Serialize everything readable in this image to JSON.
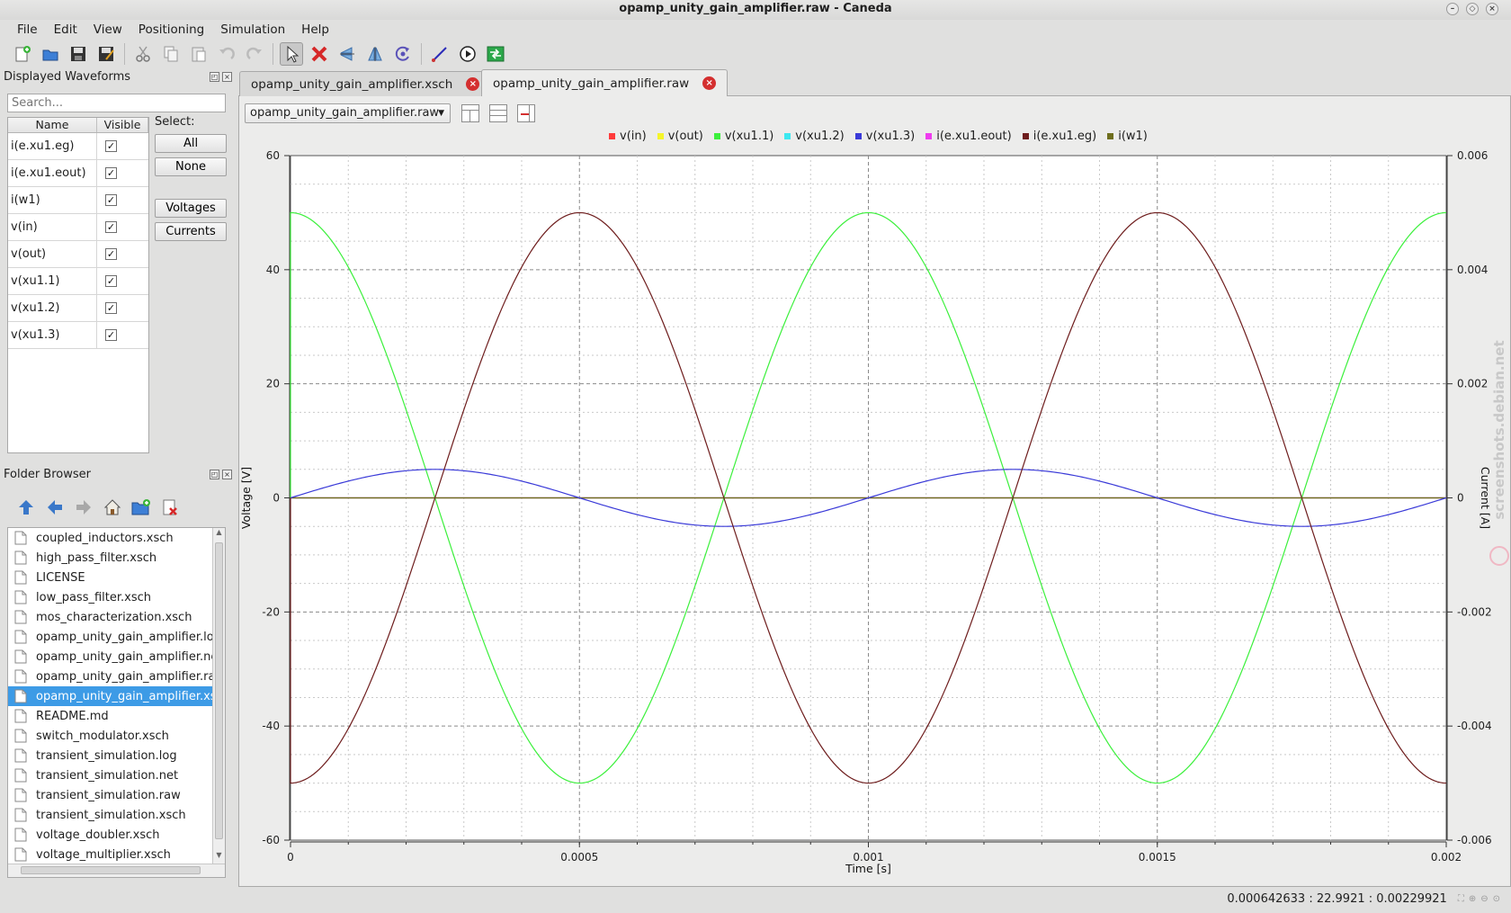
{
  "window": {
    "title": "opamp_unity_gain_amplifier.raw - Caneda"
  },
  "menu": [
    "File",
    "Edit",
    "View",
    "Positioning",
    "Simulation",
    "Help"
  ],
  "toolbar": [
    {
      "name": "new-file-icon"
    },
    {
      "name": "open-file-icon"
    },
    {
      "name": "save-icon"
    },
    {
      "name": "save-all-icon"
    },
    {
      "name": "cut-icon"
    },
    {
      "name": "copy-icon"
    },
    {
      "name": "paste-icon"
    },
    {
      "name": "undo-icon"
    },
    {
      "name": "redo-icon"
    },
    {
      "name": "select-tool-icon"
    },
    {
      "name": "delete-tool-icon"
    },
    {
      "name": "mirror-x-icon"
    },
    {
      "name": "mirror-y-icon"
    },
    {
      "name": "rotate-icon"
    },
    {
      "name": "wire-tool-icon"
    },
    {
      "name": "simulate-icon"
    },
    {
      "name": "open-waveform-icon"
    }
  ],
  "waveforms_panel": {
    "title": "Displayed Waveforms",
    "search_placeholder": "Search...",
    "columns": [
      "Name",
      "Visible"
    ],
    "rows": [
      {
        "name": "i(e.xu1.eg)",
        "visible": true
      },
      {
        "name": "i(e.xu1.eout)",
        "visible": true
      },
      {
        "name": "i(w1)",
        "visible": true
      },
      {
        "name": "v(in)",
        "visible": true
      },
      {
        "name": "v(out)",
        "visible": true
      },
      {
        "name": "v(xu1.1)",
        "visible": true
      },
      {
        "name": "v(xu1.2)",
        "visible": true
      },
      {
        "name": "v(xu1.3)",
        "visible": true
      }
    ],
    "select_label": "Select:",
    "buttons": {
      "all": "All",
      "none": "None",
      "voltages": "Voltages",
      "currents": "Currents"
    }
  },
  "folder_browser": {
    "title": "Folder Browser",
    "files": [
      "coupled_inductors.xsch",
      "high_pass_filter.xsch",
      "LICENSE",
      "low_pass_filter.xsch",
      "mos_characterization.xsch",
      "opamp_unity_gain_amplifier.log",
      "opamp_unity_gain_amplifier.net",
      "opamp_unity_gain_amplifier.raw",
      "opamp_unity_gain_amplifier.xsch",
      "README.md",
      "switch_modulator.xsch",
      "transient_simulation.log",
      "transient_simulation.net",
      "transient_simulation.raw",
      "transient_simulation.xsch",
      "voltage_doubler.xsch",
      "voltage_multiplier.xsch"
    ],
    "selected": "opamp_unity_gain_amplifier.xsch"
  },
  "tabs": [
    {
      "label": "opamp_unity_gain_amplifier.xsch",
      "active": false
    },
    {
      "label": "opamp_unity_gain_amplifier.raw",
      "active": true
    }
  ],
  "waveform_view": {
    "file_combo": "opamp_unity_gain_amplifier.raw"
  },
  "chart_data": {
    "type": "line",
    "xlabel": "Time [s]",
    "ylabel_left": "Voltage [V]",
    "ylabel_right": "Current [A]",
    "xlim": [
      0,
      0.002
    ],
    "ylim_left": [
      -60,
      60
    ],
    "ylim_right": [
      -0.006,
      0.006
    ],
    "x_ticks": [
      "0",
      "0.0005",
      "0.001",
      "0.0015",
      "0.002"
    ],
    "y_ticks_left": [
      "60",
      "40",
      "20",
      "0",
      "-20",
      "-40",
      "-60"
    ],
    "y_ticks_right": [
      "0.006",
      "0.004",
      "0.002",
      "0",
      "-0.002",
      "-0.004",
      "-0.006"
    ],
    "grid": true,
    "legend_position": "top-center",
    "series": [
      {
        "name": "v(in)",
        "color": "#ff3b3b",
        "axis": "left",
        "shape": "zero",
        "amplitude": 0
      },
      {
        "name": "v(out)",
        "color": "#f5f52a",
        "axis": "left",
        "shape": "zero",
        "amplitude": 0
      },
      {
        "name": "v(xu1.1)",
        "color": "#3cf03c",
        "axis": "left",
        "shape": "cos",
        "amplitude": 50,
        "frequency_hz": 1000
      },
      {
        "name": "v(xu1.2)",
        "color": "#3ce8f0",
        "axis": "left",
        "shape": "zero",
        "amplitude": 0
      },
      {
        "name": "v(xu1.3)",
        "color": "#3a3ad8",
        "axis": "left",
        "shape": "sin",
        "amplitude": 5,
        "frequency_hz": 1000
      },
      {
        "name": "i(e.xu1.eout)",
        "color": "#ef3cef",
        "axis": "right",
        "shape": "zero",
        "amplitude": 0
      },
      {
        "name": "i(e.xu1.eg)",
        "color": "#6e1d1d",
        "axis": "right",
        "shape": "negcos",
        "amplitude": 0.005,
        "frequency_hz": 1000
      },
      {
        "name": "i(w1)",
        "color": "#6e6e1d",
        "axis": "right",
        "shape": "zero",
        "amplitude": 0
      }
    ]
  },
  "status": {
    "coordinates": "0.000642633 : 22.9921 : 0.00229921"
  },
  "watermark": "screenshots.debian.net"
}
